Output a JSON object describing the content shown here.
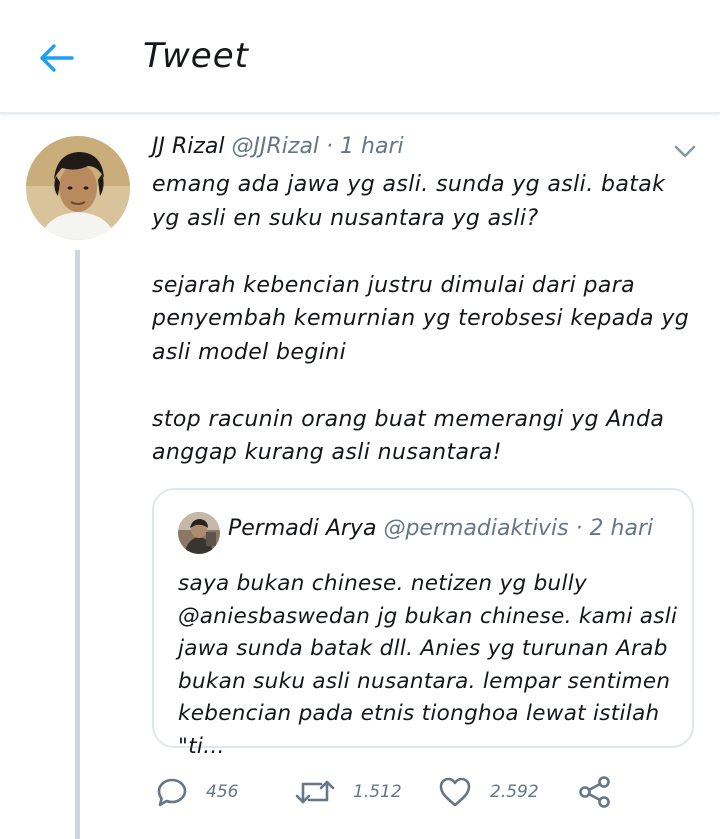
{
  "header": {
    "title": "Tweet",
    "back_icon": "arrow-left-icon",
    "accent": "#1da1f2"
  },
  "tweet": {
    "author_name": "JJ Rizal",
    "author_handle": "@JJRizal",
    "separator": "·",
    "time": "1 hari",
    "text": [
      "emang ada jawa yg asli. sunda yg asli. batak yg asli en suku nusantara yg asli?",
      "sejarah kebencian justru dimulai dari para penyembah kemurnian yg terobsesi kepada yg asli model begini",
      "stop racunin orang buat memerangi yg Anda anggap kurang asli nusantara!"
    ]
  },
  "quote": {
    "author_name": "Permadi Arya",
    "author_handle": "@permadiaktivis",
    "separator": "·",
    "time": "2 hari",
    "text": "saya bukan chinese. netizen yg bully @aniesbaswedan jg bukan chinese. kami asli jawa sunda batak dll. Anies yg turunan Arab bukan suku asli nusantara. lempar sentimen kebencian pada etnis tionghoa lewat istilah \"ti..."
  },
  "actions": {
    "reply_count": "456",
    "retweet_count": "1.512",
    "like_count": "2.592",
    "icons": [
      "reply-icon",
      "retweet-icon",
      "like-icon",
      "share-icon"
    ]
  }
}
